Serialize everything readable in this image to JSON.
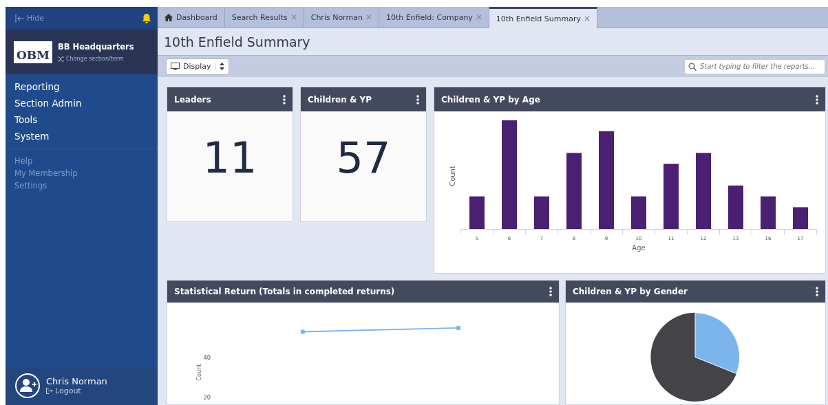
{
  "sidebar": {
    "hide_label": "Hide",
    "org_name": "BB Headquarters",
    "logo_text": "OBM",
    "change_label": "Change section/term",
    "main_items": [
      "Reporting",
      "Section Admin",
      "Tools",
      "System"
    ],
    "secondary_items": [
      "Help",
      "My Membership",
      "Settings"
    ],
    "user": {
      "name": "Chris Norman",
      "logout": "Logout"
    }
  },
  "tabs": [
    {
      "label": "Dashboard",
      "kind": "home",
      "selected": false
    },
    {
      "label": "Search Results",
      "kind": "closable",
      "selected": false
    },
    {
      "label": "Chris Norman",
      "kind": "closable",
      "selected": false
    },
    {
      "label": "10th Enfield: Company",
      "kind": "closable",
      "selected": false
    },
    {
      "label": "10th Enfield Summary",
      "kind": "closable",
      "selected": true
    }
  ],
  "page_title": "10th Enfield Summary",
  "toolbar": {
    "display_label": "Display",
    "filter_placeholder": "Start typing to filter the reports..."
  },
  "stats": [
    {
      "title": "Leaders",
      "value": "11"
    },
    {
      "title": "Children & YP",
      "value": "57"
    }
  ],
  "age_chart": {
    "title": "Children & YP by Age",
    "ylabel": "Count",
    "xlabel": "Age",
    "categories": [
      "5",
      "6",
      "7",
      "8",
      "9",
      "10",
      "11",
      "12",
      "13",
      "16",
      "17"
    ]
  },
  "return_chart": {
    "title": "Statistical Return (Totals in completed returns)",
    "ylabel": "Count",
    "ytick_labels": [
      "40",
      "20"
    ]
  },
  "gender_chart": {
    "title": "Children & YP by Gender"
  }
}
